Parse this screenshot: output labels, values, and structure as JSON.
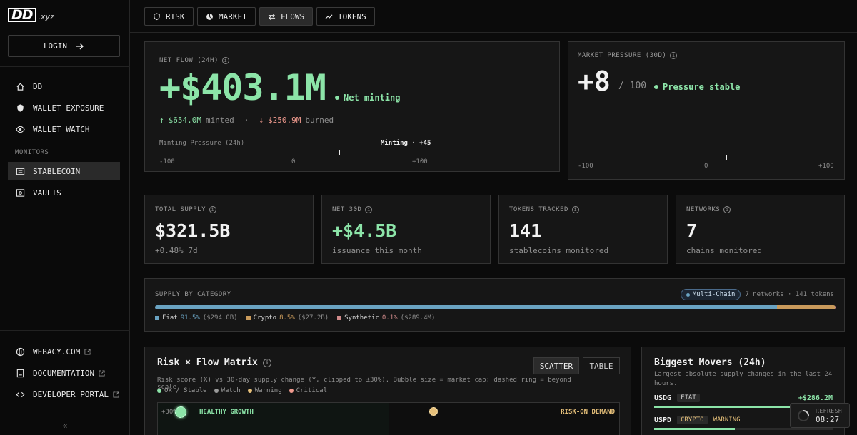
{
  "brand": {
    "logo": "DD",
    "suffix": ".xyz"
  },
  "sidebar": {
    "login_label": "LOGIN",
    "items": [
      {
        "label": "DD",
        "icon": "home-icon"
      },
      {
        "label": "WALLET EXPOSURE",
        "icon": "shield-icon"
      },
      {
        "label": "WALLET WATCH",
        "icon": "eye-icon"
      }
    ],
    "section_label": "MONITORS",
    "monitors": [
      {
        "label": "STABLECOIN",
        "icon": "list-icon",
        "active": true
      },
      {
        "label": "VAULTS",
        "icon": "vault-icon"
      }
    ],
    "links": [
      {
        "label": "WEBACY.COM",
        "icon": "globe-icon"
      },
      {
        "label": "DOCUMENTATION",
        "icon": "book-icon"
      },
      {
        "label": "DEVELOPER PORTAL",
        "icon": "code-icon"
      }
    ],
    "collapse_label": "«"
  },
  "tabs": [
    {
      "label": "RISK",
      "icon": "shield-icon"
    },
    {
      "label": "MARKET",
      "icon": "pie-icon"
    },
    {
      "label": "FLOWS",
      "icon": "arrows-icon",
      "active": true
    },
    {
      "label": "TOKENS",
      "icon": "trend-icon"
    }
  ],
  "net_flow": {
    "label": "NET FLOW (24H)",
    "value": "+$403.1M",
    "status": "Net minting",
    "minted_value": "$654.0M",
    "minted_label": "minted",
    "separator": "·",
    "burned_value": "$250.9M",
    "burned_label": "burned",
    "pressure_label": "Minting Pressure (24h)",
    "pressure_marker": "Minting · +45",
    "pressure_level": 45,
    "scale_min": "-100",
    "scale_mid": "0",
    "scale_max": "+100"
  },
  "market_pressure": {
    "label": "MARKET PRESSURE (30D)",
    "value": "+8",
    "denominator": "/ 100",
    "status": "Pressure stable",
    "level": 8,
    "scale_min": "-100",
    "scale_mid": "0",
    "scale_max": "+100"
  },
  "stats": [
    {
      "label": "TOTAL SUPPLY",
      "value": "$321.5B",
      "sub": "+0.48% 7d",
      "accent": false
    },
    {
      "label": "NET 30D",
      "value": "+$4.5B",
      "sub": "issuance this month",
      "accent": true
    },
    {
      "label": "TOKENS TRACKED",
      "value": "141",
      "sub": "stablecoins monitored",
      "accent": false
    },
    {
      "label": "NETWORKS",
      "value": "7",
      "sub": "chains monitored",
      "accent": false
    }
  ],
  "supply": {
    "label": "SUPPLY BY CATEGORY",
    "badge": "Multi-Chain",
    "summary": "7 networks · 141 tokens",
    "segments": [
      {
        "name": "Fiat",
        "pct": "91.5%",
        "amount": "($294.0B)",
        "share": 91.5,
        "color": "#6aa3c2"
      },
      {
        "name": "Crypto",
        "pct": "8.5%",
        "amount": "($27.2B)",
        "share": 8.5,
        "color": "#c99a5b"
      },
      {
        "name": "Synthetic",
        "pct": "0.1%",
        "amount": "($289.4M)",
        "share": 0.1,
        "color": "#d08a8a"
      }
    ]
  },
  "matrix": {
    "title": "Risk × Flow Matrix",
    "scatter_label": "SCATTER",
    "table_label": "TABLE",
    "description": "Risk score (X) vs 30-day supply change (Y, clipped to ±30%). Bubble size = market cap; dashed ring = beyond scale.",
    "legend": [
      {
        "name": "Ok / Stable",
        "color": "#8ce4a8"
      },
      {
        "name": "Watch",
        "color": "#9a9a9a"
      },
      {
        "name": "Warning",
        "color": "#e6c07a"
      },
      {
        "name": "Critical",
        "color": "#f09a8e"
      }
    ],
    "y_tick": "+30%",
    "quadrant_left": "HEALTHY GROWTH",
    "quadrant_right": "RISK-ON DEMAND"
  },
  "movers": {
    "title": "Biggest Movers (24h)",
    "subtitle": "Largest absolute supply changes in the last 24 hours.",
    "rows": [
      {
        "symbol": "USDG",
        "category": "FIAT",
        "change": "+$286.2M",
        "status": "",
        "level": 100
      },
      {
        "symbol": "USPD",
        "category": "CRYPTO",
        "status": "WARNING",
        "change": "",
        "level": 45
      }
    ]
  },
  "refresh": {
    "label": "REFRESH",
    "time": "08:27"
  }
}
